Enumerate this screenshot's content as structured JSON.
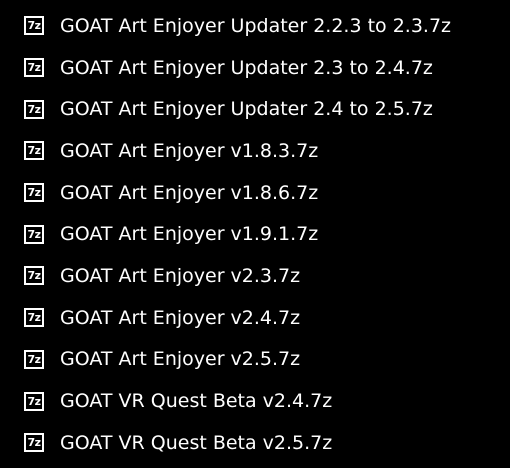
{
  "colors": {
    "background": "#000000",
    "text": "#ffffff"
  },
  "files": [
    {
      "icon": "7z-archive-icon",
      "icon_text": "7z",
      "name": "GOAT Art Enjoyer Updater 2.2.3 to 2.3.7z"
    },
    {
      "icon": "7z-archive-icon",
      "icon_text": "7z",
      "name": "GOAT Art Enjoyer Updater 2.3 to 2.4.7z"
    },
    {
      "icon": "7z-archive-icon",
      "icon_text": "7z",
      "name": "GOAT Art Enjoyer Updater 2.4 to 2.5.7z"
    },
    {
      "icon": "7z-archive-icon",
      "icon_text": "7z",
      "name": "GOAT Art Enjoyer v1.8.3.7z"
    },
    {
      "icon": "7z-archive-icon",
      "icon_text": "7z",
      "name": "GOAT Art Enjoyer v1.8.6.7z"
    },
    {
      "icon": "7z-archive-icon",
      "icon_text": "7z",
      "name": "GOAT Art Enjoyer v1.9.1.7z"
    },
    {
      "icon": "7z-archive-icon",
      "icon_text": "7z",
      "name": "GOAT Art Enjoyer v2.3.7z"
    },
    {
      "icon": "7z-archive-icon",
      "icon_text": "7z",
      "name": "GOAT Art Enjoyer v2.4.7z"
    },
    {
      "icon": "7z-archive-icon",
      "icon_text": "7z",
      "name": "GOAT Art Enjoyer v2.5.7z"
    },
    {
      "icon": "7z-archive-icon",
      "icon_text": "7z",
      "name": "GOAT VR Quest Beta v2.4.7z"
    },
    {
      "icon": "7z-archive-icon",
      "icon_text": "7z",
      "name": "GOAT VR Quest Beta v2.5.7z"
    }
  ]
}
